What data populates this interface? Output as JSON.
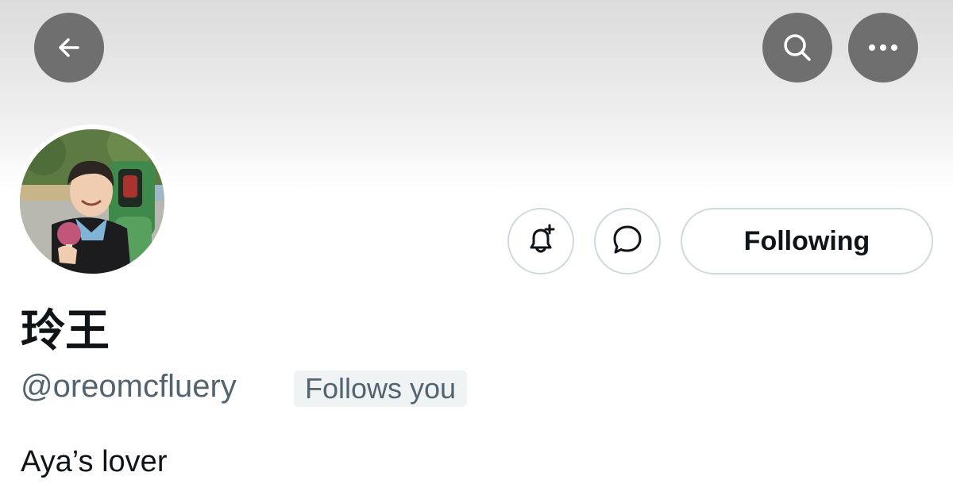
{
  "nav": {
    "back_icon": "arrow-left-icon",
    "search_icon": "search-icon",
    "more_icon": "more-horizontal-icon"
  },
  "profile": {
    "display_name": "玲王",
    "handle": "@oreomcfluery",
    "follows_you_label": "Follows you",
    "bio": "Aya’s lover"
  },
  "actions": {
    "notify_icon": "bell-plus-icon",
    "message_icon": "message-bubble-icon",
    "following_label": "Following"
  },
  "colors": {
    "nav_button_bg": "#6f6f6f",
    "text_primary": "#0f1419",
    "text_secondary": "#536471",
    "border": "#cfd9de",
    "badge_bg": "#eff3f4"
  }
}
